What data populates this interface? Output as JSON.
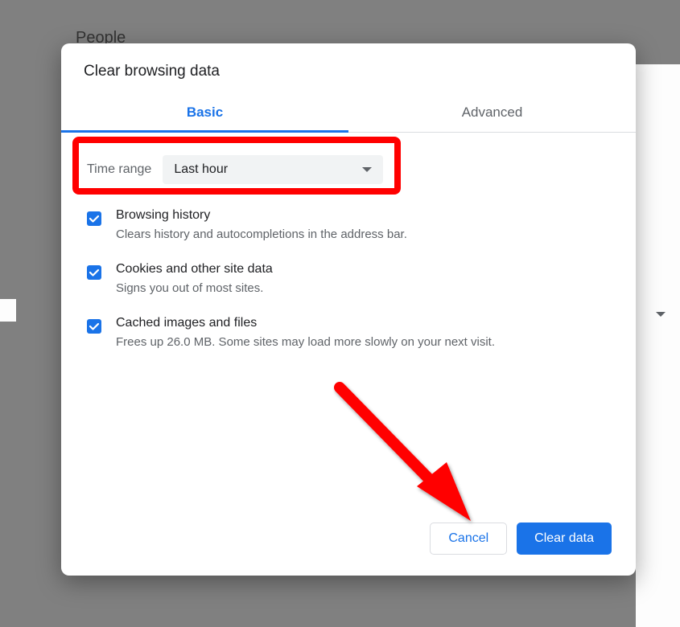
{
  "background": {
    "header": "People"
  },
  "dialog": {
    "title": "Clear browsing data",
    "tabs": {
      "basic": "Basic",
      "advanced": "Advanced"
    },
    "time_range": {
      "label": "Time range",
      "value": "Last hour"
    },
    "options": {
      "history": {
        "title": "Browsing history",
        "desc": "Clears history and autocompletions in the address bar."
      },
      "cookies": {
        "title": "Cookies and other site data",
        "desc": "Signs you out of most sites."
      },
      "cache": {
        "title": "Cached images and files",
        "desc": "Frees up 26.0 MB. Some sites may load more slowly on your next visit."
      }
    },
    "buttons": {
      "cancel": "Cancel",
      "clear": "Clear data"
    }
  },
  "annotation": {
    "highlight_color": "#ff0000",
    "arrow_color": "#ff0000"
  }
}
